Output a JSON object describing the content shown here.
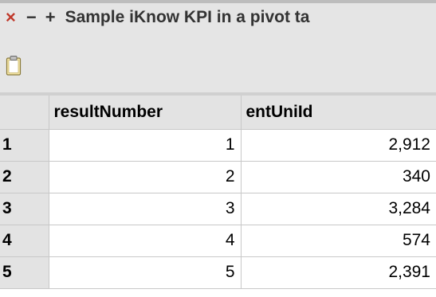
{
  "window": {
    "close_glyph": "×",
    "minimize_glyph": "−",
    "maximize_glyph": "+",
    "title": "Sample iKnow KPI in a pivot ta"
  },
  "toolbar": {
    "icons": [
      "clipboard-icon"
    ]
  },
  "table": {
    "columns": [
      "resultNumber",
      "entUniId"
    ],
    "rows": [
      {
        "row": "1",
        "resultNumber": "1",
        "entUniId": "2,912"
      },
      {
        "row": "2",
        "resultNumber": "2",
        "entUniId": "340"
      },
      {
        "row": "3",
        "resultNumber": "3",
        "entUniId": "3,284"
      },
      {
        "row": "4",
        "resultNumber": "4",
        "entUniId": "574"
      },
      {
        "row": "5",
        "resultNumber": "5",
        "entUniId": "2,391"
      }
    ]
  },
  "colors": {
    "close": "#c0392b",
    "header_bg": "#e3e3e3",
    "toolbar_bg": "#e5e5e5",
    "clipboard_fill": "#f5e6a8"
  }
}
